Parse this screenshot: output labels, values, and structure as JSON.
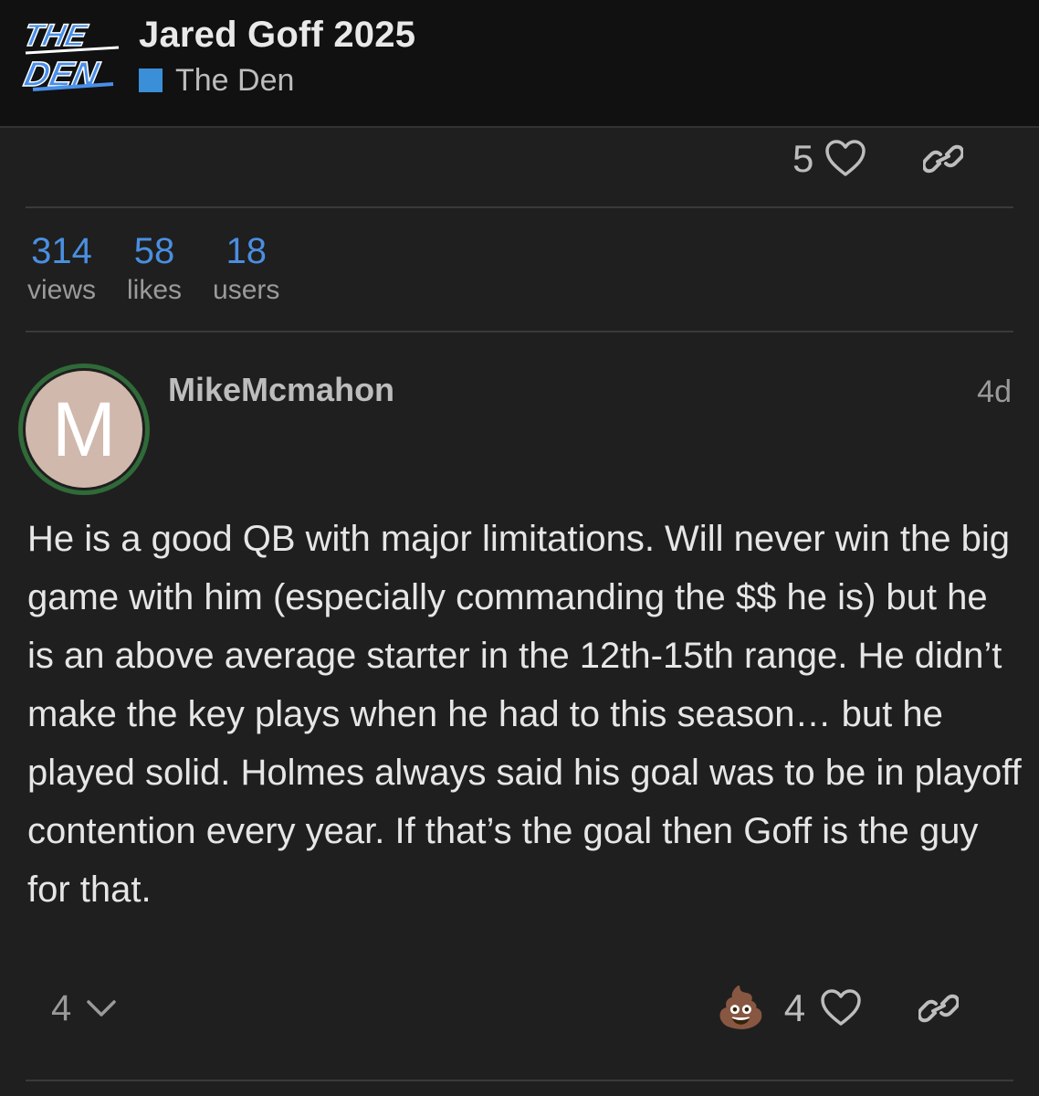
{
  "header": {
    "logo_text": "THE DEN",
    "topic_title": "Jared Goff 2025",
    "category_name": "The Den",
    "category_color": "#3a8fd8"
  },
  "prev_post": {
    "like_count": "5"
  },
  "stats": [
    {
      "number": "314",
      "label": "views"
    },
    {
      "number": "58",
      "label": "likes"
    },
    {
      "number": "18",
      "label": "users"
    }
  ],
  "post": {
    "avatar_letter": "M",
    "username": "MikeMcmahon",
    "age": "4d",
    "body": "He is a good QB with major limitations. Will never win the big game with him (especially commanding the $$ he is) but he is an above average starter in the 12th-15th range. He didn’t make the key plays when he had to this season… but he played solid. Holmes always said his goal was to be in playoff contention every year. If that’s the goal then Goff is the guy for that.",
    "reply_count": "4",
    "reaction_emoji": "💩",
    "like_count": "4"
  },
  "colors": {
    "accent_blue": "#4a8fe0",
    "avatar_ring": "#2f6a38",
    "avatar_bg": "#d0b8ac"
  }
}
